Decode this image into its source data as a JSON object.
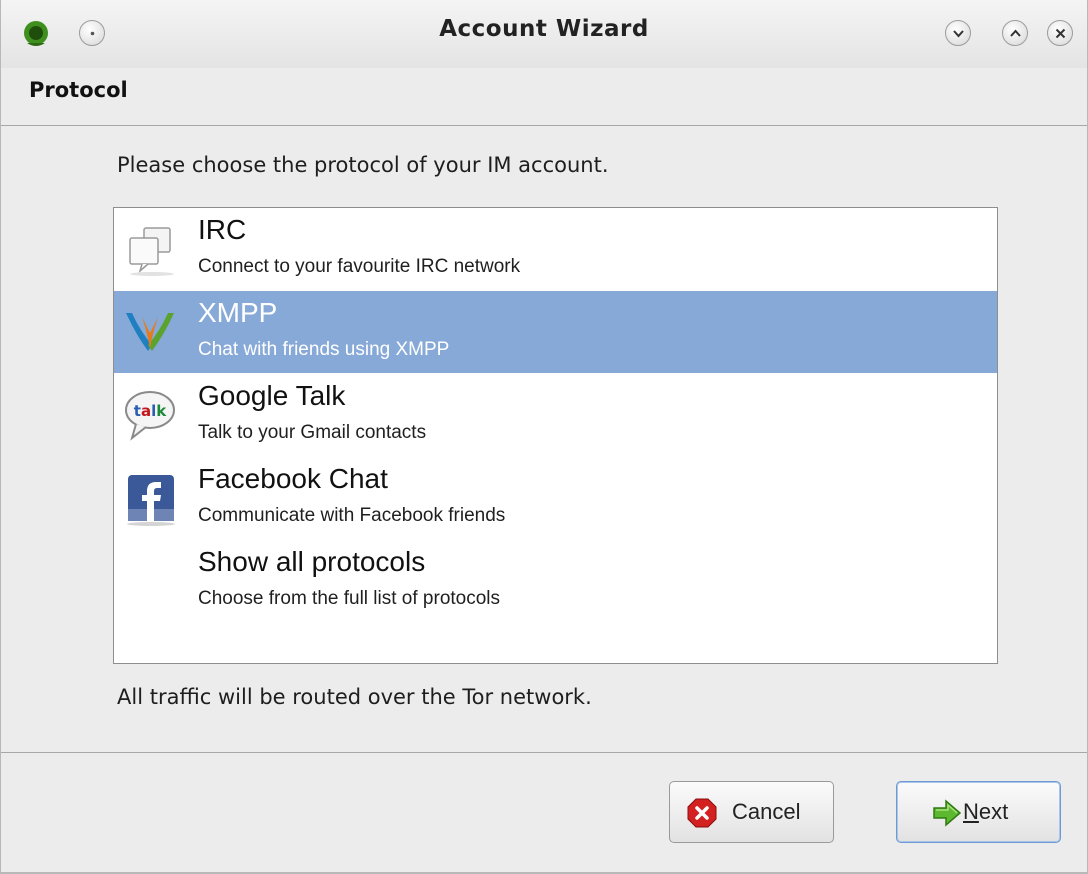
{
  "window": {
    "title": "Account Wizard"
  },
  "header": {
    "title": "Protocol"
  },
  "prompt": "Please choose the protocol of your IM account.",
  "protocols": [
    {
      "name": "IRC",
      "description": "Connect to your favourite IRC network",
      "icon": "irc-chat-icon",
      "selected": false
    },
    {
      "name": "XMPP",
      "description": "Chat with friends using XMPP",
      "icon": "xmpp-icon",
      "selected": true
    },
    {
      "name": "Google Talk",
      "description": "Talk to your Gmail contacts",
      "icon": "google-talk-icon",
      "selected": false
    },
    {
      "name": "Facebook Chat",
      "description": "Communicate with Facebook friends",
      "icon": "facebook-icon",
      "selected": false
    },
    {
      "name": "Show all protocols",
      "description": "Choose from the full list of protocols",
      "icon": null,
      "selected": false
    }
  ],
  "footer_note": "All traffic will be routed over the Tor network.",
  "buttons": {
    "cancel": "Cancel",
    "next_mnemonic": "N",
    "next_rest": "ext"
  },
  "colors": {
    "selection": "#87a9d7",
    "window_bg": "#ececec"
  }
}
